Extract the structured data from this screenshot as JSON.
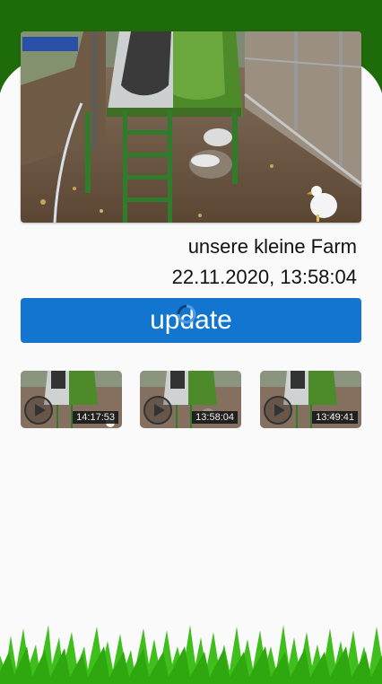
{
  "header": {
    "bg_color": "#1e6b0a"
  },
  "camera": {
    "image_icon": "chicken-coop-photo",
    "farm_name": "unsere kleine Farm",
    "timestamp": "22.11.2020, 13:58:04"
  },
  "update_button": {
    "label": "update",
    "color": "#1276d0",
    "spinner_icon": "loading-spinner"
  },
  "videos": [
    {
      "time": "14:17:53",
      "icon": "play-circle-icon"
    },
    {
      "time": "13:58:04",
      "icon": "play-circle-icon"
    },
    {
      "time": "13:49:41",
      "icon": "play-circle-icon"
    }
  ],
  "footer": {
    "decoration": "grass",
    "grass_color": "#3fbf1c"
  }
}
